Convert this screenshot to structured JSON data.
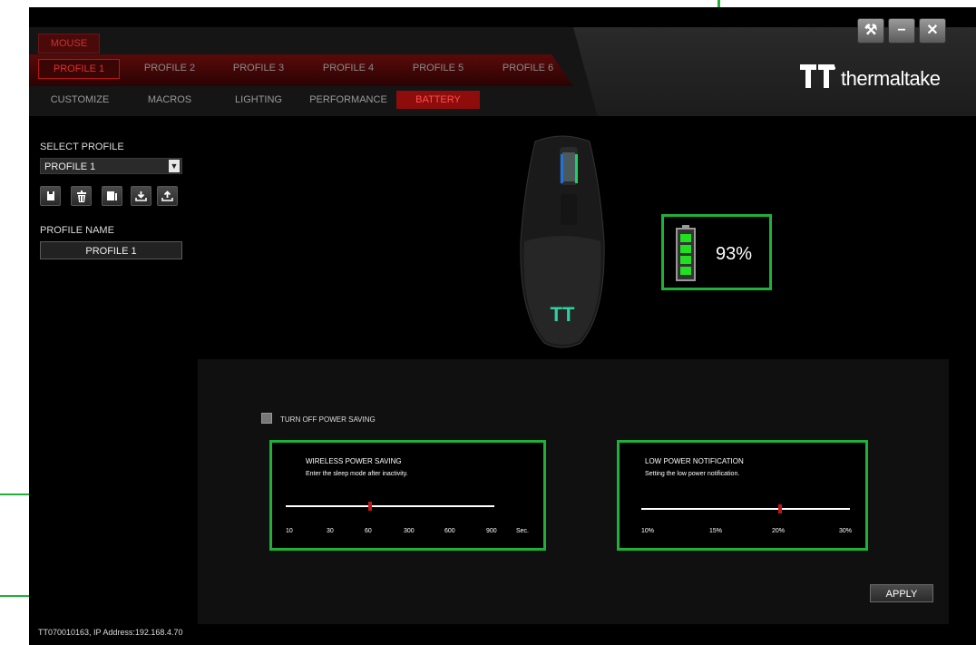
{
  "nav": {
    "mouse_tab": "MOUSE",
    "profiles": [
      "PROFILE 1",
      "PROFILE 2",
      "PROFILE 3",
      "PROFILE 4",
      "PROFILE 5",
      "PROFILE 6"
    ],
    "sections": [
      "CUSTOMIZE",
      "MACROS",
      "LIGHTING",
      "PERFORMANCE",
      "BATTERY"
    ]
  },
  "brand": {
    "name": "thermaltake"
  },
  "sidebar": {
    "select_profile_label": "SELECT PROFILE",
    "selected_profile": "PROFILE 1",
    "profile_name_label": "PROFILE NAME",
    "profile_name_value": "PROFILE 1",
    "icons": [
      "save-icon",
      "delete-icon",
      "copy-icon",
      "import-icon",
      "export-icon"
    ]
  },
  "battery": {
    "level_text": "93%",
    "level": 93
  },
  "power": {
    "turn_off_label": "TURN OFF POWER SAVING",
    "turn_off_checked": false,
    "wireless": {
      "title": "WIRELESS POWER SAVING",
      "description": "Enter the sleep mode after inactivity.",
      "ticks": [
        "10",
        "30",
        "60",
        "300",
        "600",
        "900"
      ],
      "unit": "Sec.",
      "value": "60"
    },
    "low_power": {
      "title": "LOW POWER NOTIFICATION",
      "description": "Setting the low power notification.",
      "ticks": [
        "10%",
        "15%",
        "20%",
        "30%"
      ],
      "value": "20%"
    }
  },
  "apply_label": "APPLY",
  "status": {
    "footer": "TT070010163, IP Address:192.168.4.70"
  },
  "colors": {
    "accent_red": "#b01818",
    "highlight_green": "#1fb038"
  }
}
